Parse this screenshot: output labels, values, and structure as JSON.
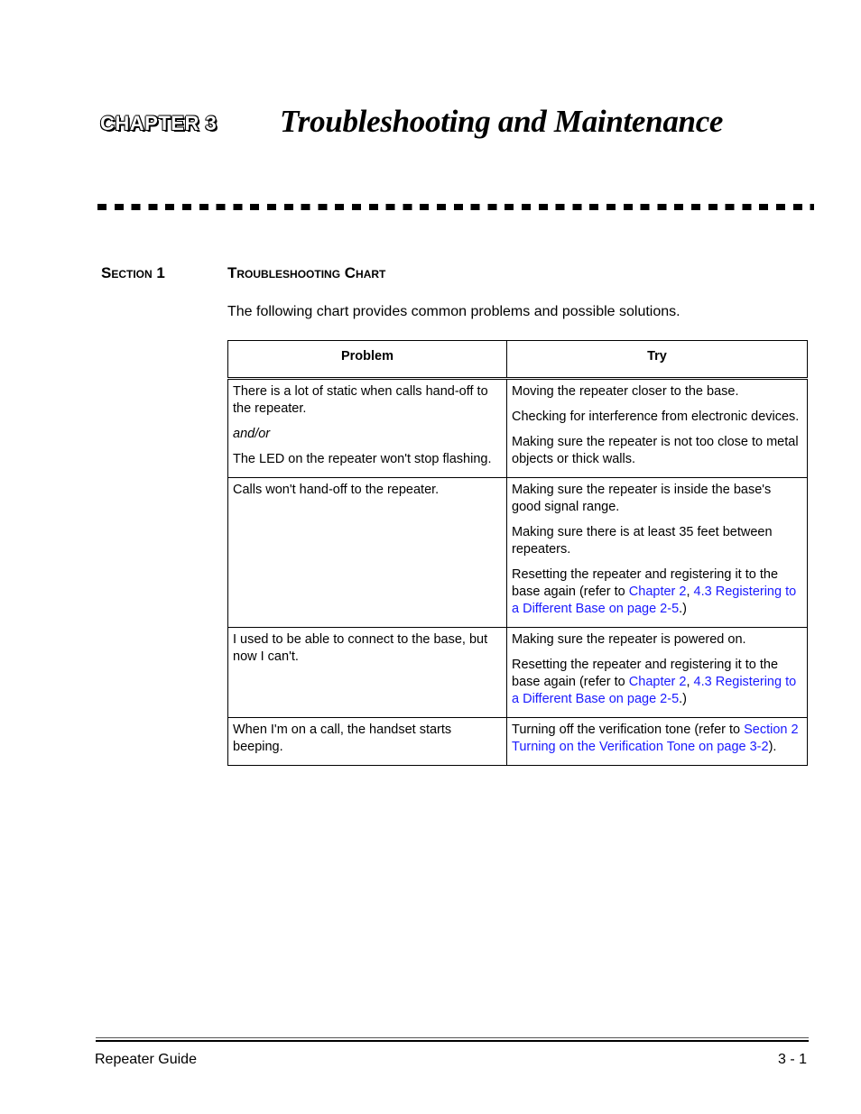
{
  "header": {
    "chapter_label": "CHAPTER 3",
    "chapter_title": "Troubleshooting and Maintenance"
  },
  "section": {
    "number": "Section 1",
    "title": "Troubleshooting Chart",
    "intro": "The following chart provides common problems and possible solutions."
  },
  "table": {
    "headers": [
      "Problem",
      "Try"
    ],
    "rows": [
      {
        "problem": {
          "p1": "There is a lot of static when calls hand-off to the repeater.",
          "andor": "and/or",
          "p2": "The LED on the repeater won't stop flashing."
        },
        "try": {
          "t1": "Moving the repeater closer to the base.",
          "t2": "Checking for interference from electronic devices.",
          "t3": "Making sure the repeater is not too close to metal objects or thick walls."
        }
      },
      {
        "problem": {
          "p1": "Calls won't hand-off to the repeater."
        },
        "try": {
          "t1": "Making sure the repeater is inside the base's good signal range.",
          "t2": "Making sure there is at least 35 feet between repeaters.",
          "t3_prefix": "Resetting the repeater and registering it to the base again (refer to ",
          "t3_link1": "Chapter 2",
          "t3_sep": ", ",
          "t3_link2": "4.3 Registering to a Different Base on page 2-5",
          "t3_suffix": ".)"
        }
      },
      {
        "problem": {
          "p1": "I used to be able to connect to the base, but now I can't."
        },
        "try": {
          "t1": "Making sure the repeater is powered on.",
          "t2_prefix": "Resetting the repeater and registering it to the base again (refer to ",
          "t2_link1": "Chapter 2",
          "t2_sep": ", ",
          "t2_link2": "4.3 Registering to a Different Base on page 2-5",
          "t2_suffix": ".)"
        }
      },
      {
        "problem": {
          "p1": "When I'm on a call, the handset starts beeping."
        },
        "try": {
          "t1_prefix": "Turning off the verification tone (refer to ",
          "t1_link": "Section 2 Turning on the Verification Tone on page 3-2",
          "t1_suffix": ")."
        }
      }
    ]
  },
  "footer": {
    "left": "Repeater Guide",
    "right": "3 - 1"
  },
  "colors": {
    "link": "#1a1aff",
    "text": "#000000"
  }
}
